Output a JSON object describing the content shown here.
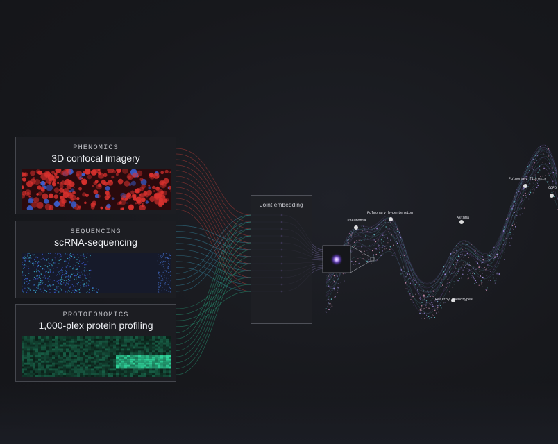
{
  "sources": [
    {
      "category": "PHENOMICS",
      "title": "3D confocal imagery",
      "accent": "#e0453f"
    },
    {
      "category": "SEQUENCING",
      "title": "scRNA-sequencing",
      "accent": "#3fa8c9"
    },
    {
      "category": "PROTOEONOMICS",
      "title": "1,000-plex protein profiling",
      "accent": "#2dbf8e"
    }
  ],
  "embedding": {
    "label": "Joint embedding",
    "accent": "#9a6cff"
  },
  "landscape": {
    "peaks": [
      "Pneumonia",
      "Pulmonary hypertension",
      "Asthma",
      "Pulmonary fibrosis",
      "COPD"
    ],
    "valley": "Healthy phenotypes"
  }
}
